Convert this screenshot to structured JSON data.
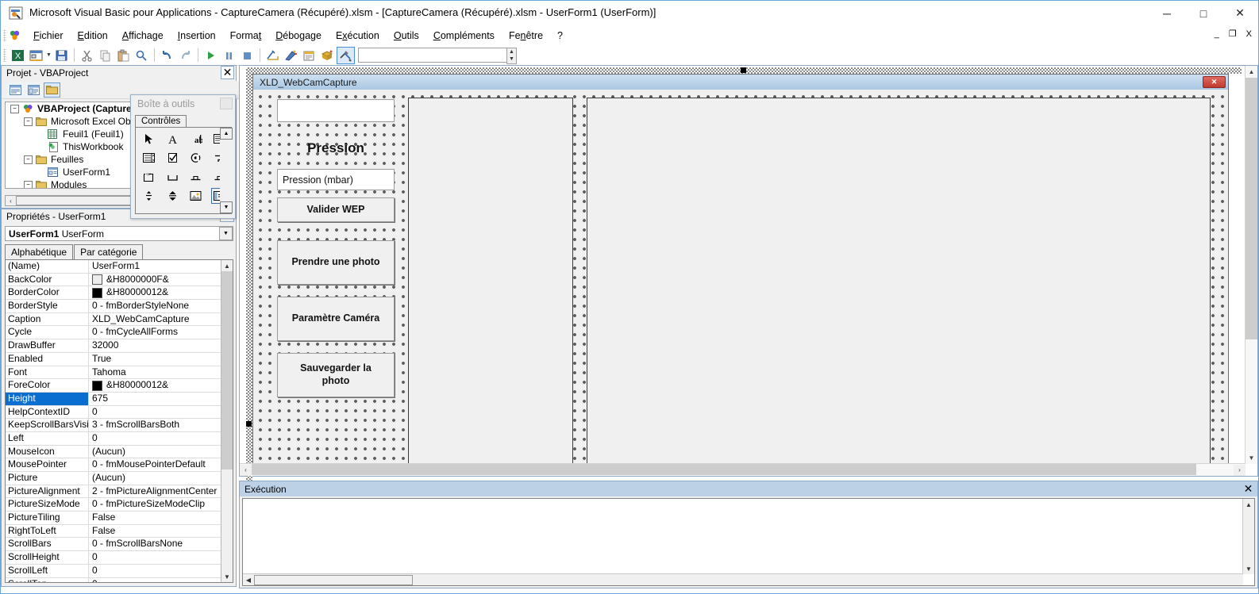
{
  "window": {
    "title": "Microsoft Visual Basic pour Applications - CaptureCamera (Récupéré).xlsm - [CaptureCamera (Récupéré).xlsm - UserForm1 (UserForm)]",
    "minimize": "─",
    "maximize": "□",
    "close": "✕",
    "mdi_minimize": "_",
    "mdi_restore": "❐",
    "mdi_close": "X"
  },
  "menubar": {
    "items": [
      {
        "label": "Fichier",
        "accel": "F"
      },
      {
        "label": "Edition",
        "accel": "E"
      },
      {
        "label": "Affichage",
        "accel": "A"
      },
      {
        "label": "Insertion",
        "accel": "I"
      },
      {
        "label": "Format",
        "accel": "t"
      },
      {
        "label": "Débogage",
        "accel": "D"
      },
      {
        "label": "Exécution",
        "accel": "x"
      },
      {
        "label": "Outils",
        "accel": "O"
      },
      {
        "label": "Compléments",
        "accel": "C"
      },
      {
        "label": "Fenêtre",
        "accel": "n"
      },
      {
        "label": "?",
        "accel": "?"
      }
    ]
  },
  "toolbar": {
    "buttons": [
      "excel-view-icon",
      "insert-userform-icon",
      "dropdown-caret",
      "save-icon",
      "cut-icon",
      "copy-icon",
      "paste-icon",
      "find-icon",
      "undo-icon",
      "redo-icon",
      "run-icon",
      "break-icon",
      "reset-icon",
      "design-mode-icon",
      "project-explorer-icon",
      "properties-window-icon",
      "object-browser-icon",
      "toolbox-icon",
      "help-icon"
    ],
    "combo_value": ""
  },
  "project": {
    "caption": "Projet - VBAProject",
    "close_label": "✕",
    "toolbar_buttons": [
      "view-code-icon",
      "view-object-icon",
      "toggle-folders-icon"
    ],
    "tree": [
      {
        "label": "VBAProject (CaptureC",
        "depth": 0,
        "expander": "−",
        "icon": "vbaproject-icon",
        "bold": true
      },
      {
        "label": "Microsoft Excel Objets",
        "depth": 1,
        "expander": "−",
        "icon": "folder-icon",
        "bold": false
      },
      {
        "label": "Feuil1 (Feuil1)",
        "depth": 2,
        "expander": "",
        "icon": "worksheet-icon",
        "bold": false
      },
      {
        "label": "ThisWorkbook",
        "depth": 2,
        "expander": "",
        "icon": "workbook-icon",
        "bold": false
      },
      {
        "label": "Feuilles",
        "depth": 1,
        "expander": "−",
        "icon": "folder-icon",
        "bold": false
      },
      {
        "label": "UserForm1",
        "depth": 2,
        "expander": "",
        "icon": "userform-icon",
        "bold": false
      },
      {
        "label": "Modules",
        "depth": 1,
        "expander": "−",
        "icon": "folder-icon",
        "bold": false
      }
    ],
    "hscroll_left": "‹"
  },
  "toolbox": {
    "caption": "Boîte à outils",
    "tab": "Contrôles",
    "controls": [
      "select-objects-icon",
      "label-icon",
      "textbox-icon",
      "combobox-icon",
      "listbox-icon",
      "checkbox-icon",
      "optionbutton-icon",
      "togglebutton-icon",
      "frame-icon",
      "commandbutton-icon",
      "tabstrip-icon",
      "multipage-icon",
      "scrollbar-icon",
      "spinbutton-icon",
      "image-icon",
      "refedit-icon"
    ],
    "scroll_up": "▲",
    "scroll_down": "▼"
  },
  "properties": {
    "caption": "Propriétés - UserForm1",
    "collapse_label": "⌃",
    "object_name": "UserForm1",
    "object_type": "UserForm",
    "combo_arrow": "▼",
    "tabs": [
      {
        "label": "Alphabétique",
        "selected": true
      },
      {
        "label": "Par catégorie",
        "selected": false
      }
    ],
    "scroll_up": "▲",
    "scroll_down": "▼",
    "rows": [
      {
        "name": "(Name)",
        "value": "UserForm1",
        "swatch": "",
        "selected": false
      },
      {
        "name": "BackColor",
        "value": "&H8000000F&",
        "swatch": "#ececec",
        "selected": false
      },
      {
        "name": "BorderColor",
        "value": "&H80000012&",
        "swatch": "#000000",
        "selected": false
      },
      {
        "name": "BorderStyle",
        "value": "0 - fmBorderStyleNone",
        "swatch": "",
        "selected": false
      },
      {
        "name": "Caption",
        "value": "XLD_WebCamCapture",
        "swatch": "",
        "selected": false
      },
      {
        "name": "Cycle",
        "value": "0 - fmCycleAllForms",
        "swatch": "",
        "selected": false
      },
      {
        "name": "DrawBuffer",
        "value": "32000",
        "swatch": "",
        "selected": false
      },
      {
        "name": "Enabled",
        "value": "True",
        "swatch": "",
        "selected": false
      },
      {
        "name": "Font",
        "value": "Tahoma",
        "swatch": "",
        "selected": false
      },
      {
        "name": "ForeColor",
        "value": "&H80000012&",
        "swatch": "#000000",
        "selected": false
      },
      {
        "name": "Height",
        "value": "675",
        "swatch": "",
        "selected": true
      },
      {
        "name": "HelpContextID",
        "value": "0",
        "swatch": "",
        "selected": false
      },
      {
        "name": "KeepScrollBarsVisible",
        "value": "3 - fmScrollBarsBoth",
        "swatch": "",
        "selected": false
      },
      {
        "name": "Left",
        "value": "0",
        "swatch": "",
        "selected": false
      },
      {
        "name": "MouseIcon",
        "value": "(Aucun)",
        "swatch": "",
        "selected": false
      },
      {
        "name": "MousePointer",
        "value": "0 - fmMousePointerDefault",
        "swatch": "",
        "selected": false
      },
      {
        "name": "Picture",
        "value": "(Aucun)",
        "swatch": "",
        "selected": false
      },
      {
        "name": "PictureAlignment",
        "value": "2 - fmPictureAlignmentCenter",
        "swatch": "",
        "selected": false
      },
      {
        "name": "PictureSizeMode",
        "value": "0 - fmPictureSizeModeClip",
        "swatch": "",
        "selected": false
      },
      {
        "name": "PictureTiling",
        "value": "False",
        "swatch": "",
        "selected": false
      },
      {
        "name": "RightToLeft",
        "value": "False",
        "swatch": "",
        "selected": false
      },
      {
        "name": "ScrollBars",
        "value": "0 - fmScrollBarsNone",
        "swatch": "",
        "selected": false
      },
      {
        "name": "ScrollHeight",
        "value": "0",
        "swatch": "",
        "selected": false
      },
      {
        "name": "ScrollLeft",
        "value": "0",
        "swatch": "",
        "selected": false
      },
      {
        "name": "ScrollTop",
        "value": "0",
        "swatch": "",
        "selected": false
      }
    ]
  },
  "designer": {
    "form_caption": "XLD_WebCamCapture",
    "form_close_label": "✕",
    "controls": {
      "textbox_value": "",
      "pressure_label": "Pression",
      "pressure_input": "Pression (mbar)",
      "validate_button": "Valider WEP",
      "photo_button": "Prendre une photo",
      "camera_button": "Paramètre Caméra",
      "save_button": "Sauvegarder la photo"
    },
    "hscroll_left": "‹",
    "hscroll_right": "›",
    "vscroll_up": "▲",
    "vscroll_down": "▼"
  },
  "immediate": {
    "caption": "Exécution",
    "close_label": "✕",
    "content": "",
    "scroll_up": "▲",
    "scroll_down": "▼",
    "hscroll_left": "◀"
  }
}
